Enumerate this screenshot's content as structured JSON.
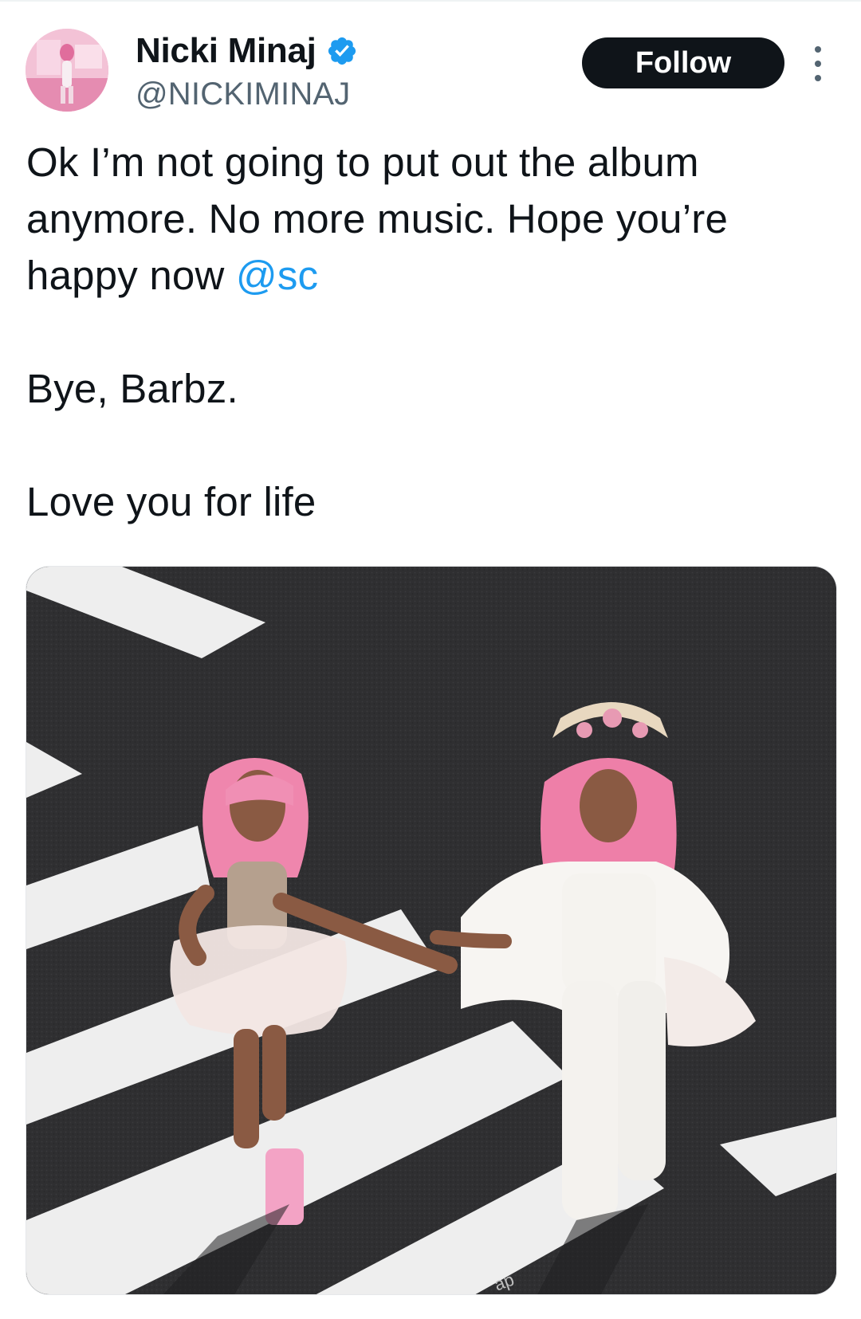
{
  "tweet": {
    "author": {
      "display_name": "Nicki Minaj",
      "handle": "@NICKIMINAJ",
      "verified": true
    },
    "follow_label": "Follow",
    "text": {
      "line1": "Ok I’m not going to put out the album anymore. No more music. Hope you’re happy now ",
      "mention": "@sc",
      "line2": "Bye, Barbz.",
      "line3": "Love you for life"
    },
    "media": {
      "watermark": "ap"
    }
  },
  "colors": {
    "text": "#0f1419",
    "secondary": "#536471",
    "link": "#1d9bf0",
    "verified": "#1d9bf0",
    "follow_bg": "#0f1419"
  },
  "icons": {
    "verified": "verified-badge-icon",
    "more": "more-options-icon"
  }
}
